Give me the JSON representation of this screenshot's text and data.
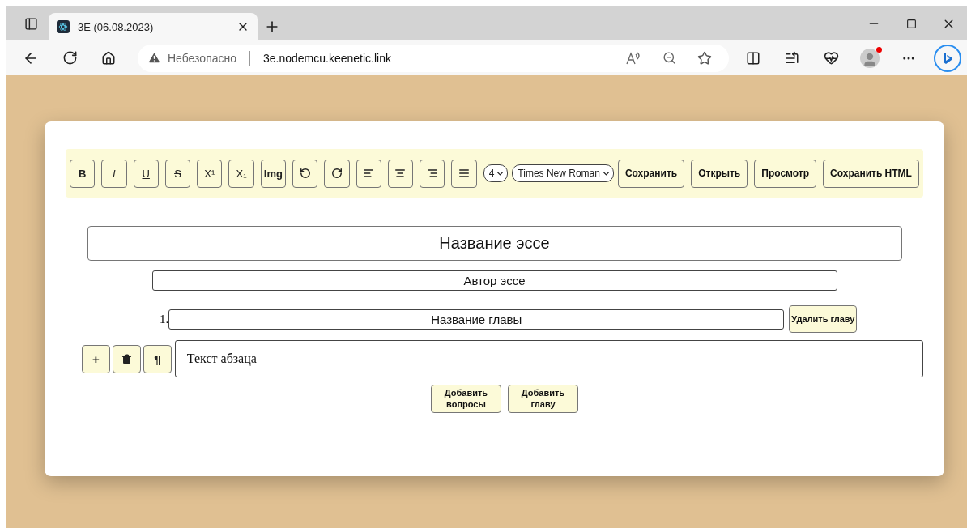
{
  "browser": {
    "tab": {
      "title": "3E (06.08.2023)"
    },
    "security": "Небезопасно",
    "url": "3e.nodemcu.keenetic.link"
  },
  "toolbar": {
    "buttons": [
      {
        "kind": "bold",
        "label": "B"
      },
      {
        "kind": "italic",
        "label": "I"
      },
      {
        "kind": "underline",
        "label": "U"
      },
      {
        "kind": "strike",
        "label": "S"
      },
      {
        "kind": "plain",
        "label": "X¹"
      },
      {
        "kind": "plain",
        "label": "X₁"
      },
      {
        "kind": "bold",
        "label": "Img"
      },
      {
        "kind": "undo"
      },
      {
        "kind": "redo"
      },
      {
        "kind": "align-left"
      },
      {
        "kind": "align-center"
      },
      {
        "kind": "align-right"
      },
      {
        "kind": "justify"
      }
    ],
    "size_select": "4",
    "font_select": "Times New Roman",
    "actions": [
      "Сохранить",
      "Открыть",
      "Просмотр",
      "Сохранить HTML"
    ]
  },
  "essay": {
    "title": "Название эссе",
    "author": "Автор эссе",
    "chapters": [
      {
        "number": "1.",
        "title": "Название главы",
        "delete_button": "Удалить главу",
        "paragraphs": [
          {
            "add_button": "+",
            "style_button": "¶",
            "text": "Текст абзаца"
          }
        ]
      }
    ],
    "buttons": [
      "Добавить вопросы",
      "Добавить главу"
    ]
  }
}
